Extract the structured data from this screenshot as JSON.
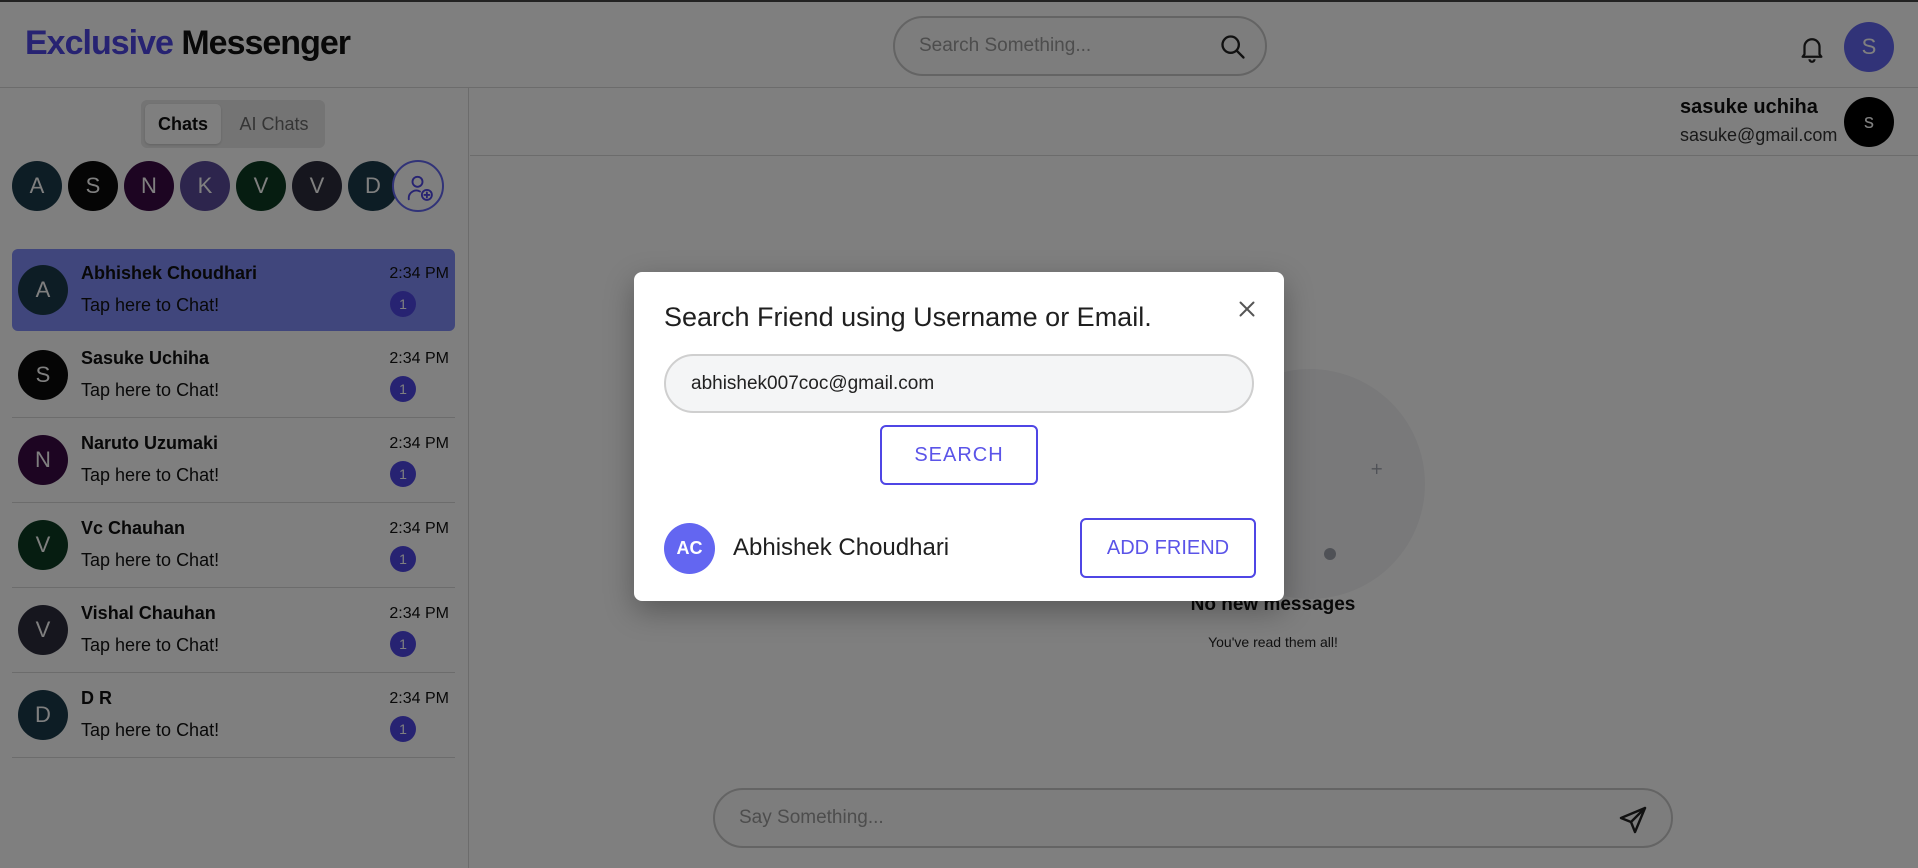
{
  "header": {
    "logo_part1": "Exclusive",
    "logo_part2": "Messenger",
    "search_placeholder": "Search Something...",
    "user_initial": "S"
  },
  "sidebar": {
    "tabs": [
      {
        "label": "Chats",
        "active": true
      },
      {
        "label": "AI Chats",
        "active": false
      }
    ],
    "quick_avatars": [
      {
        "initial": "A",
        "color": "#1b3a4b"
      },
      {
        "initial": "S",
        "color": "#0a0a0a"
      },
      {
        "initial": "N",
        "color": "#3b0a45"
      },
      {
        "initial": "K",
        "color": "#5b4b9b"
      },
      {
        "initial": "V",
        "color": "#0d3b22"
      },
      {
        "initial": "V",
        "color": "#2d2d3d"
      },
      {
        "initial": "D",
        "color": "#1b3a4b"
      }
    ],
    "chats": [
      {
        "initial": "A",
        "name": "Abhishek Choudhari",
        "preview": "Tap here to Chat!",
        "time": "2:34 PM",
        "unread": "1",
        "color": "#1b3a4b",
        "active": true
      },
      {
        "initial": "S",
        "name": "Sasuke Uchiha",
        "preview": "Tap here to Chat!",
        "time": "2:34 PM",
        "unread": "1",
        "color": "#0a0a0a",
        "active": false
      },
      {
        "initial": "N",
        "name": "Naruto Uzumaki",
        "preview": "Tap here to Chat!",
        "time": "2:34 PM",
        "unread": "1",
        "color": "#3b0a45",
        "active": false
      },
      {
        "initial": "V",
        "name": "Vc Chauhan",
        "preview": "Tap here to Chat!",
        "time": "2:34 PM",
        "unread": "1",
        "color": "#0d3b22",
        "active": false
      },
      {
        "initial": "V",
        "name": "Vishal Chauhan",
        "preview": "Tap here to Chat!",
        "time": "2:34 PM",
        "unread": "1",
        "color": "#2d2d3d",
        "active": false
      },
      {
        "initial": "D",
        "name": "D R",
        "preview": "Tap here to Chat!",
        "time": "2:34 PM",
        "unread": "1",
        "color": "#1b3a4b",
        "active": false
      }
    ]
  },
  "main": {
    "current_user": {
      "name": "sasuke uchiha",
      "email": "sasuke@gmail.com",
      "initial": "s"
    },
    "empty_title": "No new messages",
    "empty_subtitle": "You've read them all!",
    "compose_placeholder": "Say Something..."
  },
  "modal": {
    "title": "Search Friend using Username or Email.",
    "input_value": "abhishek007coc@gmail.com",
    "search_label": "SEARCH",
    "result": {
      "initials": "AC",
      "name": "Abhishek Choudhari"
    },
    "add_friend_label": "ADD FRIEND"
  },
  "colors": {
    "accent": "#4f46e5",
    "active_chat": "#818cf8",
    "overlay": "rgba(0,0,0,0.5)"
  },
  "icons": [
    "search-icon",
    "bell-icon",
    "add-user-icon",
    "send-icon",
    "close-icon"
  ]
}
